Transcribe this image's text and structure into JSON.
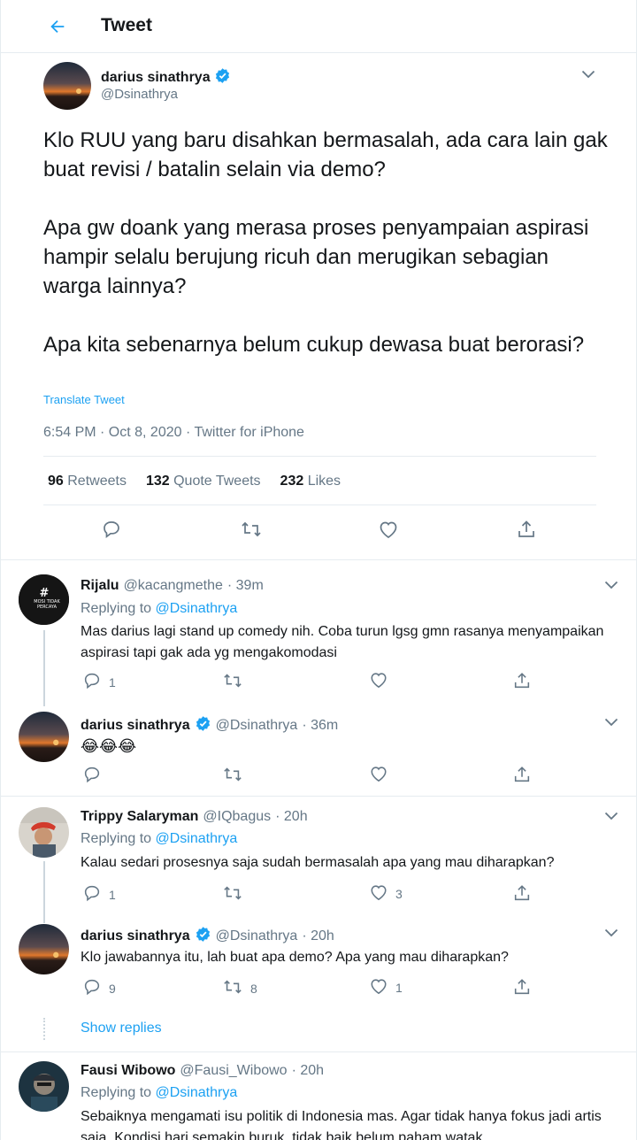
{
  "header": {
    "title": "Tweet"
  },
  "main_tweet": {
    "author": {
      "name": "darius sinathrya",
      "handle": "@Dsinathrya",
      "verified": true
    },
    "text": "Klo RUU yang baru disahkan bermasalah, ada cara lain gak buat revisi / batalin selain via demo?\n\nApa gw doank yang merasa proses penyampaian aspirasi hampir selalu berujung ricuh dan merugikan sebagian warga lainnya?\n\nApa kita sebenarnya belum cukup dewasa buat berorasi?",
    "translate_label": "Translate Tweet",
    "meta": "6:54 PM · Oct 8, 2020 · Twitter for iPhone",
    "stats": {
      "retweets_count": "96",
      "retweets_label": "Retweets",
      "quotes_count": "132",
      "quotes_label": "Quote Tweets",
      "likes_count": "232",
      "likes_label": "Likes"
    }
  },
  "replying_label": "Replying to",
  "replies": [
    {
      "name": "Rijalu",
      "handle": "@kacangmethe",
      "time": "· 39m",
      "replying_to": "@Dsinathrya",
      "text": "Mas darius lagi stand up comedy nih. Coba turun lgsg gmn rasanya menyampaikan aspirasi tapi gak ada yg mengakomodasi",
      "reply_count": "1",
      "retweet_count": "",
      "like_count": "",
      "avatar_text": "#MOSI TIDAK PERCAYA"
    },
    {
      "name": "darius sinathrya",
      "handle": "@Dsinathrya",
      "time": "· 36m",
      "text": "😂😂😂",
      "reply_count": "",
      "retweet_count": "",
      "like_count": ""
    },
    {
      "name": "Trippy Salaryman",
      "handle": "@IQbagus",
      "time": "· 20h",
      "replying_to": "@Dsinathrya",
      "text": "Kalau sedari prosesnya saja sudah bermasalah apa yang mau diharapkan?",
      "reply_count": "1",
      "retweet_count": "",
      "like_count": "3"
    },
    {
      "name": "darius sinathrya",
      "handle": "@Dsinathrya",
      "time": "· 20h",
      "text": "Klo jawabannya itu, lah buat apa demo? Apa yang mau diharapkan?",
      "reply_count": "9",
      "retweet_count": "8",
      "like_count": "1"
    },
    {
      "name": "Fausi Wibowo",
      "handle": "@Fausi_Wibowo",
      "time": "· 20h",
      "replying_to": "@Dsinathrya",
      "text": "Sebaiknya mengamati isu politik di Indonesia mas. Agar tidak hanya fokus jadi artis saja. Kondisi hari semakin buruk, tidak baik belum paham watak"
    }
  ],
  "show_replies_label": "Show replies",
  "colors": {
    "accent": "#1da1f2",
    "secondary_text": "#657786",
    "divider": "#e6ecf0"
  }
}
